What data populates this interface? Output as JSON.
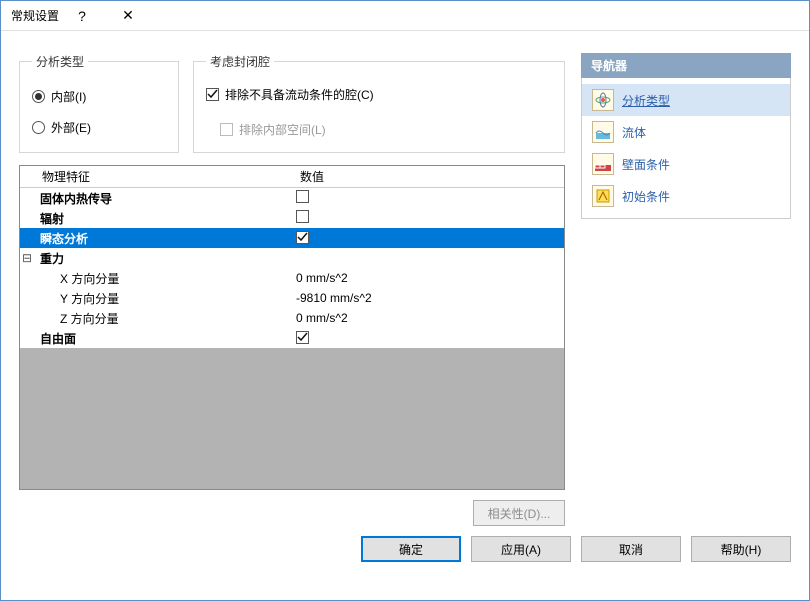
{
  "window": {
    "title": "常规设置",
    "help": "?",
    "close": "✕"
  },
  "analysis": {
    "legend": "分析类型",
    "internal": "内部(I)",
    "external": "外部(E)"
  },
  "cavity": {
    "legend": "考虑封闭腔",
    "exclude": "排除不具备流动条件的腔(C)",
    "inner": "排除内部空间(L)"
  },
  "grid": {
    "col1": "物理特征",
    "col2": "数值",
    "rows": [
      {
        "label": "固体内热传导",
        "type": "check",
        "checked": false,
        "bold": true
      },
      {
        "label": "辐射",
        "type": "check",
        "checked": false,
        "bold": true
      },
      {
        "label": "瞬态分析",
        "type": "check",
        "checked": true,
        "bold": true,
        "selected": true
      },
      {
        "label": "重力",
        "type": "expand",
        "bold": true,
        "expander": "⊟"
      },
      {
        "label": "X 方向分量",
        "type": "value",
        "value": "0 mm/s^2",
        "indent": true
      },
      {
        "label": "Y 方向分量",
        "type": "value",
        "value": "-9810 mm/s^2",
        "indent": true
      },
      {
        "label": "Z 方向分量",
        "type": "value",
        "value": "0 mm/s^2",
        "indent": true
      },
      {
        "label": "自由面",
        "type": "check",
        "checked": true,
        "bold": true
      }
    ]
  },
  "deps_button": "相关性(D)...",
  "buttons": {
    "ok": "确定",
    "apply": "应用(A)",
    "cancel": "取消",
    "help": "帮助(H)"
  },
  "nav": {
    "title": "导航器",
    "items": [
      {
        "label": "分析类型",
        "icon": "atom",
        "active": true
      },
      {
        "label": "流体",
        "icon": "fluid"
      },
      {
        "label": "壁面条件",
        "icon": "wall"
      },
      {
        "label": "初始条件",
        "icon": "initial"
      }
    ]
  }
}
